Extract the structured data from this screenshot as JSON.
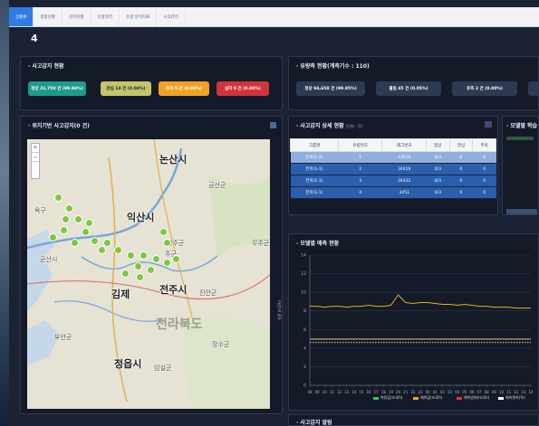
{
  "tabs": [
    {
      "label": "상황판",
      "active": true
    },
    {
      "label": "종합현황",
      "active": false
    },
    {
      "label": "감지현황",
      "active": false
    },
    {
      "label": "유량관리",
      "active": false
    },
    {
      "label": "유량 분석자료",
      "active": false
    },
    {
      "label": "사고관리",
      "active": false
    }
  ],
  "page_number": "4",
  "accident": {
    "title": "· 사고감지 현황",
    "badges": [
      {
        "label": "정상 31,750 건 (99.94%)",
        "color": "#1f9a8b"
      },
      {
        "label": "관심 14 건 (0.04%)",
        "color": "#c2c56a"
      },
      {
        "label": "주의 5 건 (0.02%)",
        "color": "#f0a227"
      },
      {
        "label": "심각 0 건 (0.00%)",
        "color": "#d0353b"
      }
    ]
  },
  "flow": {
    "title": "· 유량측 현황(계측기수 : 110)",
    "badges": [
      {
        "label": "정상 94,658 건 (99.95%)"
      },
      {
        "label": "불일 45 건 (0.05%)"
      },
      {
        "label": "유측 2 건 (0.00%)"
      }
    ]
  },
  "map": {
    "title": "· 위치기반 사고감지(0 건)",
    "labels": [
      {
        "text": "논산시",
        "kind": "normal"
      },
      {
        "text": "익산시",
        "kind": "normal"
      },
      {
        "text": "김제",
        "kind": "normal"
      },
      {
        "text": "전주시",
        "kind": "normal"
      },
      {
        "text": "정읍시",
        "kind": "normal"
      },
      {
        "text": "전라북도",
        "kind": "big"
      },
      {
        "text": "금산군",
        "kind": "sm"
      },
      {
        "text": "진안군",
        "kind": "sm"
      },
      {
        "text": "완주군",
        "kind": "sm"
      },
      {
        "text": "무주군",
        "kind": "sm"
      },
      {
        "text": "장수군",
        "kind": "sm"
      },
      {
        "text": "임실군",
        "kind": "sm"
      },
      {
        "text": "부안군",
        "kind": "sm"
      },
      {
        "text": "군산시",
        "kind": "sm"
      },
      {
        "text": "주군",
        "kind": "sm"
      },
      {
        "text": "옥구",
        "kind": "sm"
      }
    ],
    "zoom_in": "+",
    "zoom_out": "−"
  },
  "detail": {
    "title": "· 사고감지 상세 현황",
    "subtitle": "(단위 : 건)",
    "columns": [
      "그룹명",
      "유량번호",
      "태그번호",
      "정상",
      "관심",
      "주의"
    ],
    "rows": [
      [
        "전북(1-1)",
        "1",
        "13510",
        "0/3",
        "0",
        "0"
      ],
      [
        "전북(1-1)",
        "2",
        "34419",
        "0/3",
        "0",
        "0"
      ],
      [
        "전북(1-1)",
        "3",
        "34432",
        "0/3",
        "0",
        "0"
      ],
      [
        "전북(1-1)",
        "4",
        "3451",
        "0/3",
        "0",
        "0"
      ]
    ]
  },
  "model_study": {
    "title": "· 모델별 학습"
  },
  "prediction": {
    "title": "· 모델별 예측 현황",
    "ylabel": "유량 (m3/h)",
    "legend": [
      "측정값(m3/h)",
      "예측값(m3/h)",
      "예측범위(m3/h)",
      "예측편차(%)"
    ]
  },
  "bottom": {
    "title": "· 사고감지 알림"
  },
  "chart_data": {
    "type": "line",
    "title": "",
    "xlabel": "",
    "ylabel": "유량 (m3/h)",
    "ylim": [
      0,
      14
    ],
    "yticks": [
      0,
      2,
      4,
      6,
      8,
      10,
      12,
      14
    ],
    "x": [
      "08",
      "09",
      "10",
      "11",
      "12",
      "13",
      "14",
      "15",
      "16",
      "17",
      "18",
      "19",
      "20",
      "21",
      "22",
      "23",
      "00",
      "01",
      "02",
      "03",
      "04",
      "05",
      "06",
      "07",
      "08",
      "09",
      "10",
      "11",
      "12",
      "13",
      "14"
    ],
    "series": [
      {
        "name": "측정값(m3/h)",
        "color": "#e0b020",
        "values": [
          8.5,
          8.5,
          8.4,
          8.5,
          8.5,
          8.4,
          8.5,
          8.5,
          8.6,
          8.5,
          8.5,
          8.6,
          9.7,
          8.9,
          8.8,
          8.9,
          8.9,
          8.8,
          8.7,
          8.7,
          8.6,
          8.7,
          8.6,
          8.5,
          8.5,
          8.4,
          8.4,
          8.4,
          8.3,
          8.3,
          8.3
        ]
      },
      {
        "name": "예측값(m3/h)",
        "color": "#39c46a",
        "values": [
          5.0,
          5.0,
          5.0,
          5.0,
          5.0,
          5.0,
          5.0,
          5.0,
          5.0,
          5.0,
          5.0,
          5.0,
          5.0,
          5.0,
          5.0,
          5.0,
          5.0,
          5.0,
          5.0,
          5.0,
          5.0,
          5.0,
          5.0,
          5.0,
          5.0,
          5.0,
          5.0,
          5.0,
          5.0,
          5.0,
          5.0
        ]
      },
      {
        "name": "예측범위(m3/h)",
        "color": "#e23a3a",
        "values": [
          4.9,
          4.9,
          4.9,
          4.9,
          4.9,
          4.9,
          4.9,
          4.9,
          4.9,
          4.9,
          4.9,
          4.9,
          4.9,
          4.9,
          4.9,
          4.9,
          4.9,
          4.9,
          4.9,
          4.9,
          4.9,
          4.9,
          4.9,
          4.9,
          4.9,
          4.9,
          4.9,
          4.9,
          4.9,
          4.9,
          4.9
        ]
      },
      {
        "name": "예측편차(%)",
        "color": "#ffffff",
        "values": [
          4.6,
          4.6,
          4.6,
          4.6,
          4.6,
          4.6,
          4.6,
          4.6,
          4.6,
          4.6,
          4.6,
          4.6,
          4.6,
          4.6,
          4.6,
          4.6,
          4.6,
          4.6,
          4.6,
          4.6,
          4.6,
          4.6,
          4.6,
          4.6,
          4.6,
          4.6,
          4.6,
          4.6,
          4.6,
          4.6,
          4.6
        ]
      }
    ],
    "grid": true,
    "legend": "bottom-right"
  }
}
